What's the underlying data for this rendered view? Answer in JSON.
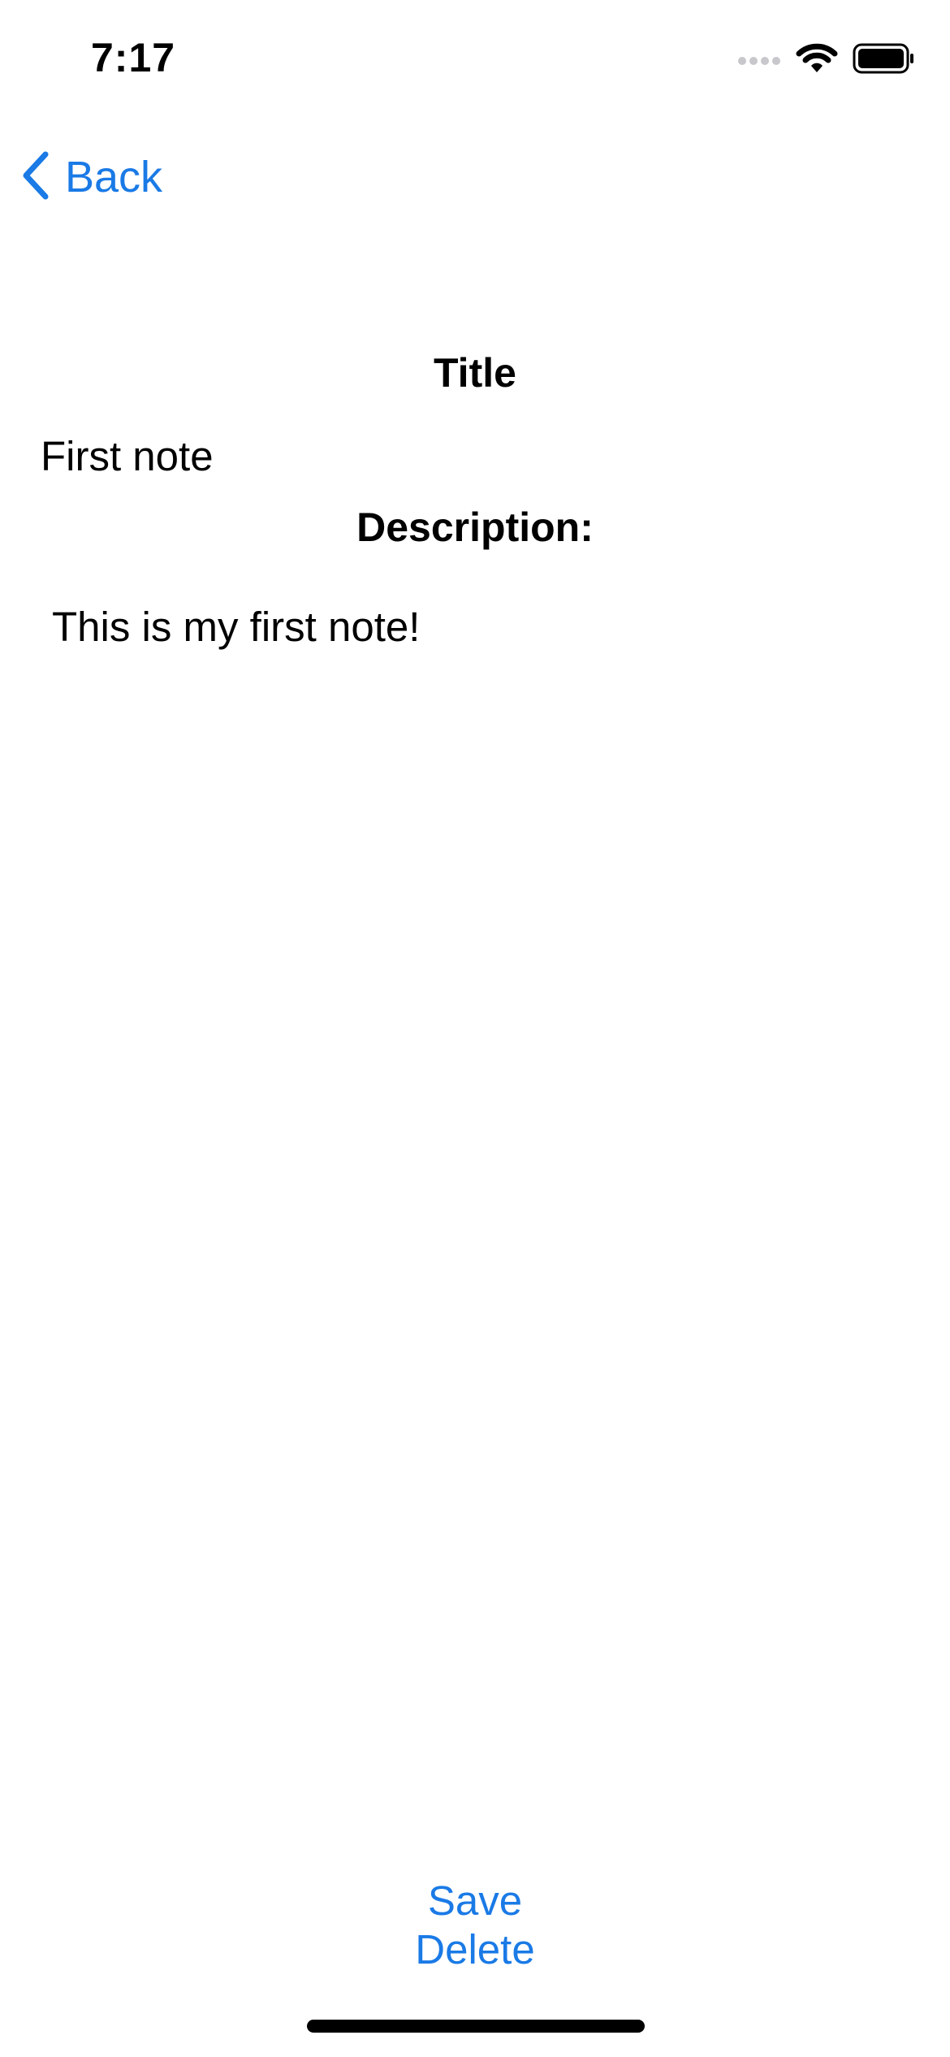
{
  "status_bar": {
    "time": "7:17"
  },
  "nav": {
    "back_label": "Back"
  },
  "note": {
    "title_heading": "Title",
    "title_value": "First note",
    "description_heading": "Description:",
    "description_value": "This is my first note!"
  },
  "actions": {
    "save_label": "Save",
    "delete_label": "Delete"
  },
  "icons": {
    "back": "chevron-left-icon",
    "signal": "cellular-signal-icon",
    "wifi": "wifi-icon",
    "battery": "battery-icon"
  },
  "colors": {
    "accent": "#1a7ae6",
    "text": "#000000",
    "background": "#ffffff",
    "signal_inactive": "#c7c7cc"
  }
}
